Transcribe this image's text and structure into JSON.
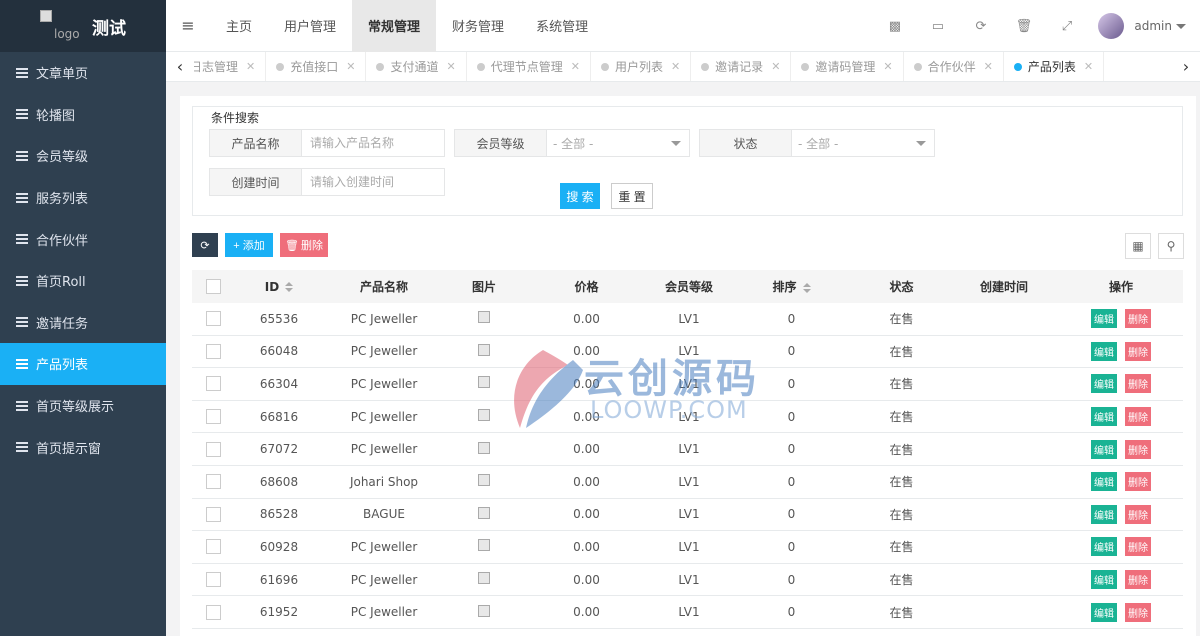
{
  "brand": {
    "logo_alt": "logo",
    "title": "测试"
  },
  "sidebar": {
    "items": [
      {
        "label": "文章单页"
      },
      {
        "label": "轮播图"
      },
      {
        "label": "会员等级"
      },
      {
        "label": "服务列表"
      },
      {
        "label": "合作伙伴"
      },
      {
        "label": "首页Roll"
      },
      {
        "label": "邀请任务"
      },
      {
        "label": "产品列表"
      },
      {
        "label": "首页等级展示"
      },
      {
        "label": "首页提示窗"
      }
    ],
    "active_index": 7
  },
  "topmenu": {
    "items": [
      {
        "label": "主页"
      },
      {
        "label": "用户管理"
      },
      {
        "label": "常规管理"
      },
      {
        "label": "财务管理"
      },
      {
        "label": "系统管理"
      }
    ],
    "active_index": 2
  },
  "header": {
    "icons": [
      "chart-icon",
      "card-icon",
      "refresh-icon",
      "trash-icon",
      "fullscreen-icon"
    ],
    "username": "admin"
  },
  "tabs": {
    "items": [
      {
        "label": "日志管理"
      },
      {
        "label": "充值接口"
      },
      {
        "label": "支付通道"
      },
      {
        "label": "代理节点管理"
      },
      {
        "label": "用户列表"
      },
      {
        "label": "邀请记录"
      },
      {
        "label": "邀请码管理"
      },
      {
        "label": "合作伙伴"
      },
      {
        "label": "产品列表"
      }
    ],
    "active_index": 8
  },
  "search": {
    "legend": "条件搜索",
    "product_name_label": "产品名称",
    "product_name_placeholder": "请输入产品名称",
    "member_level_label": "会员等级",
    "member_level_value": "- 全部 -",
    "status_label": "状态",
    "status_value": "- 全部 -",
    "created_time_label": "创建时间",
    "created_time_placeholder": "请输入创建时间",
    "search_button": "搜 索",
    "reset_button": "重 置"
  },
  "toolbar": {
    "add_label": "+ 添加",
    "delete_label": "删除"
  },
  "table": {
    "headers": {
      "id": "ID",
      "name": "产品名称",
      "image": "图片",
      "price": "价格",
      "level": "会员等级",
      "sort": "排序",
      "status": "状态",
      "created": "创建时间",
      "actions": "操作"
    },
    "edit_label": "编辑",
    "delete_label": "删除",
    "rows": [
      {
        "id": "65536",
        "name": "PC Jeweller",
        "price": "0.00",
        "level": "LV1",
        "sort": "0",
        "status": "在售",
        "created": ""
      },
      {
        "id": "66048",
        "name": "PC Jeweller",
        "price": "0.00",
        "level": "LV1",
        "sort": "0",
        "status": "在售",
        "created": ""
      },
      {
        "id": "66304",
        "name": "PC Jeweller",
        "price": "0.00",
        "level": "LV1",
        "sort": "0",
        "status": "在售",
        "created": ""
      },
      {
        "id": "66816",
        "name": "PC Jeweller",
        "price": "0.00",
        "level": "LV1",
        "sort": "0",
        "status": "在售",
        "created": ""
      },
      {
        "id": "67072",
        "name": "PC Jeweller",
        "price": "0.00",
        "level": "LV1",
        "sort": "0",
        "status": "在售",
        "created": ""
      },
      {
        "id": "68608",
        "name": "Johari Shop",
        "price": "0.00",
        "level": "LV1",
        "sort": "0",
        "status": "在售",
        "created": ""
      },
      {
        "id": "86528",
        "name": "BAGUE",
        "price": "0.00",
        "level": "LV1",
        "sort": "0",
        "status": "在售",
        "created": ""
      },
      {
        "id": "60928",
        "name": "PC Jeweller",
        "price": "0.00",
        "level": "LV1",
        "sort": "0",
        "status": "在售",
        "created": ""
      },
      {
        "id": "61696",
        "name": "PC Jeweller",
        "price": "0.00",
        "level": "LV1",
        "sort": "0",
        "status": "在售",
        "created": ""
      },
      {
        "id": "61952",
        "name": "PC Jeweller",
        "price": "0.00",
        "level": "LV1",
        "sort": "0",
        "status": "在售",
        "created": ""
      }
    ]
  },
  "watermark": {
    "cn": "云创源码",
    "en": "LOOWP.COM"
  },
  "colors": {
    "sidebar_bg": "#2f4050",
    "accent": "#1ab0f5",
    "edit": "#1ab394",
    "danger": "#ed5565"
  }
}
